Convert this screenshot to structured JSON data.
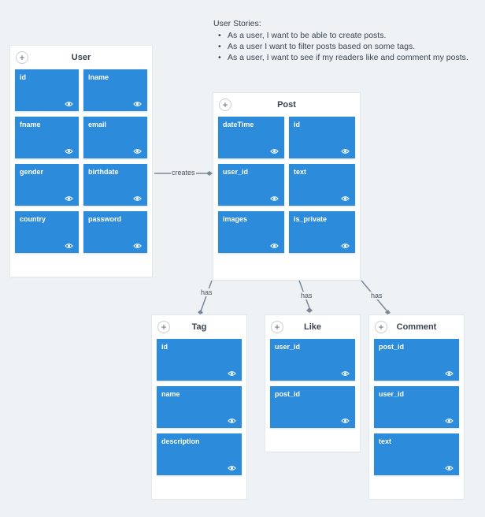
{
  "user_stories": {
    "title": "User Stories:",
    "items": [
      "As a user, I want to be able to create posts.",
      "As a user I want to filter posts based on some tags.",
      "As a user, I want to see if my readers like and comment my posts."
    ]
  },
  "add_symbol": "+",
  "tables": {
    "user": {
      "title": "User",
      "fields": [
        "id",
        "lname",
        "fname",
        "email",
        "gender",
        "birthdate",
        "country",
        "password"
      ]
    },
    "post": {
      "title": "Post",
      "fields": [
        "dateTime",
        "id",
        "user_id",
        "text",
        "images",
        "is_private"
      ]
    },
    "tag": {
      "title": "Tag",
      "fields": [
        "id",
        "name",
        "description"
      ]
    },
    "like": {
      "title": "Like",
      "fields": [
        "user_id",
        "post_id"
      ]
    },
    "comment": {
      "title": "Comment",
      "fields": [
        "post_id",
        "user_id",
        "text"
      ]
    }
  },
  "relations": {
    "creates": "creates",
    "has_tag": "has",
    "has_like": "has",
    "has_comment": "has"
  },
  "colors": {
    "field": "#2d8bdb",
    "background": "#eef2f5",
    "connector": "#7a8794"
  },
  "icons": {
    "field_visibility": "eye-icon",
    "add": "plus-icon"
  }
}
